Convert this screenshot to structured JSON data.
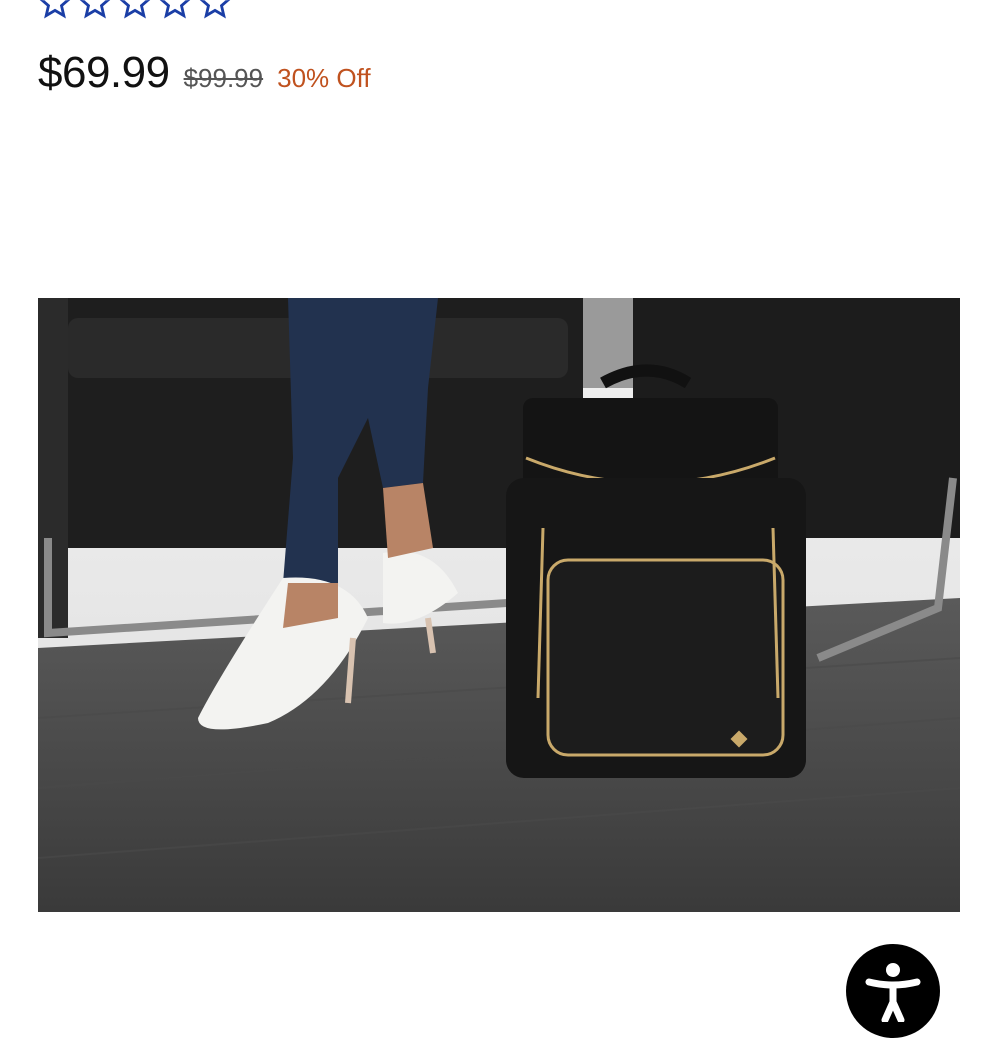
{
  "rating": {
    "stars": 5,
    "color": "#1a3ea6"
  },
  "pricing": {
    "current": "$69.99",
    "original": "$99.99",
    "discount": "30% Off",
    "discount_color": "#c0521f"
  },
  "product_image": {
    "subject": "black backpack beside seated person in white heels"
  },
  "accessibility": {
    "icon": "accessibility-icon"
  }
}
